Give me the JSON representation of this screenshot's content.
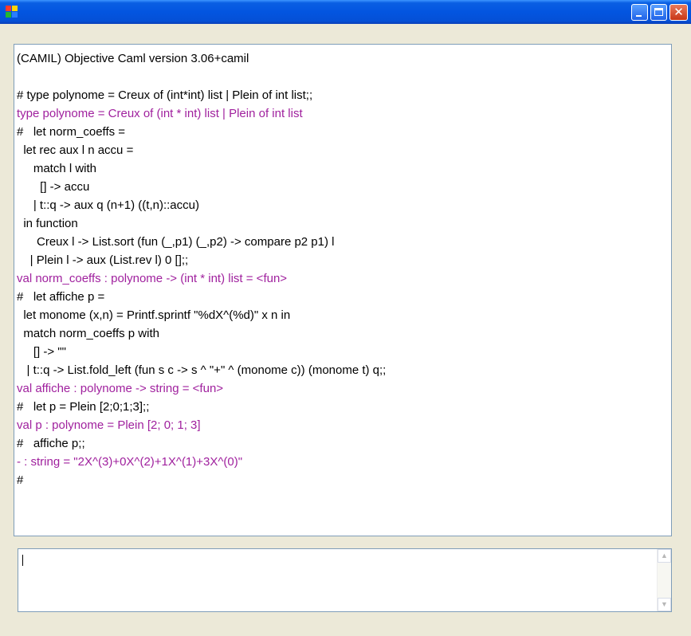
{
  "window": {
    "title": "",
    "controls": {
      "minimize": "minimize",
      "maximize": "maximize",
      "close": "✕"
    }
  },
  "console": {
    "lines": [
      {
        "text": "(CAMIL) Objective Caml version 3.06+camil",
        "kind": "in"
      },
      {
        "text": "",
        "kind": "in"
      },
      {
        "text": "# type polynome = Creux of (int*int) list | Plein of int list;;",
        "kind": "in"
      },
      {
        "text": "type polynome = Creux of (int * int) list | Plein of int list",
        "kind": "out"
      },
      {
        "text": "#   let norm_coeffs =",
        "kind": "in"
      },
      {
        "text": "  let rec aux l n accu =",
        "kind": "in"
      },
      {
        "text": "     match l with",
        "kind": "in"
      },
      {
        "text": "       [] -> accu",
        "kind": "in"
      },
      {
        "text": "     | t::q -> aux q (n+1) ((t,n)::accu)",
        "kind": "in"
      },
      {
        "text": "  in function",
        "kind": "in"
      },
      {
        "text": "      Creux l -> List.sort (fun (_,p1) (_,p2) -> compare p2 p1) l",
        "kind": "in"
      },
      {
        "text": "    | Plein l -> aux (List.rev l) 0 [];;",
        "kind": "in"
      },
      {
        "text": "val norm_coeffs : polynome -> (int * int) list = <fun>",
        "kind": "out"
      },
      {
        "text": "#   let affiche p =",
        "kind": "in"
      },
      {
        "text": "  let monome (x,n) = Printf.sprintf \"%dX^(%d)\" x n in",
        "kind": "in"
      },
      {
        "text": "  match norm_coeffs p with",
        "kind": "in"
      },
      {
        "text": "     [] -> \"\"",
        "kind": "in"
      },
      {
        "text": "   | t::q -> List.fold_left (fun s c -> s ^ \"+\" ^ (monome c)) (monome t) q;;",
        "kind": "in"
      },
      {
        "text": "val affiche : polynome -> string = <fun>",
        "kind": "out"
      },
      {
        "text": "#   let p = Plein [2;0;1;3];;",
        "kind": "in"
      },
      {
        "text": "val p : polynome = Plein [2; 0; 1; 3]",
        "kind": "out"
      },
      {
        "text": "#   affiche p;;",
        "kind": "in"
      },
      {
        "text": "- : string = \"2X^(3)+0X^(2)+1X^(1)+3X^(0)\"",
        "kind": "out"
      },
      {
        "text": "#",
        "kind": "in"
      }
    ]
  },
  "input": {
    "value": ""
  },
  "colors": {
    "output_text": "#a0219e",
    "input_text": "#000000",
    "titlebar": "#0355e0"
  }
}
